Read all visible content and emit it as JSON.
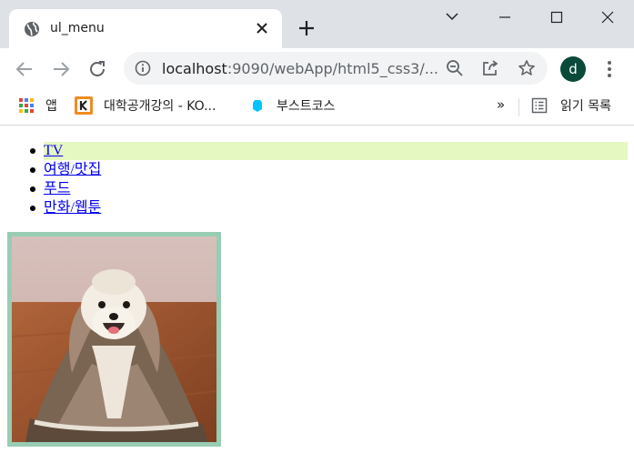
{
  "browser": {
    "tab_title": "ul_menu",
    "url_host": "localhost",
    "url_rest": ":9090/webApp/html5_css3/...",
    "profile_initial": "d"
  },
  "bookmarks": {
    "apps_label": "앱",
    "item1_label": "대학공개강의 - KO...",
    "item2_label": "부스트코스",
    "more_label": "»",
    "reading_list_label": "읽기 목록"
  },
  "menu": {
    "items": [
      {
        "label": "TV",
        "active": true
      },
      {
        "label": "여행/맛집",
        "active": false
      },
      {
        "label": "푸드",
        "active": false
      },
      {
        "label": "만화/웹툰",
        "active": false
      }
    ],
    "highlight_color": "#e6f8c2"
  },
  "image": {
    "subject": "white dog wrapped in a brown blanket",
    "border_color": "#98cdb4"
  },
  "colors": {
    "tabstrip_bg": "#dee1e6",
    "link": "#0000ee",
    "avatar_bg": "#0b4a3a"
  }
}
